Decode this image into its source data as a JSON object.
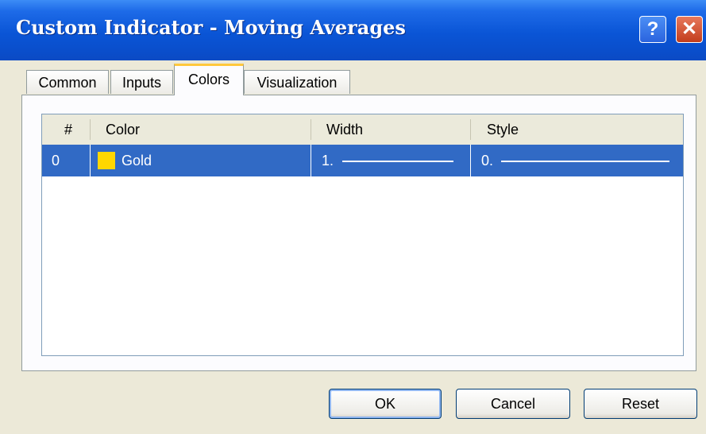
{
  "window": {
    "title": "Custom Indicator - Moving Averages",
    "help_glyph": "?",
    "close_glyph": "✕"
  },
  "tabs": [
    {
      "label": "Common"
    },
    {
      "label": "Inputs"
    },
    {
      "label": "Colors",
      "active": true
    },
    {
      "label": "Visualization"
    }
  ],
  "table": {
    "columns": [
      "#",
      "Color",
      "Width",
      "Style"
    ],
    "rows": [
      {
        "index": "0",
        "color_name": "Gold",
        "color_hex": "#FFD700",
        "width": "1.",
        "style": "0.",
        "selected": true
      }
    ]
  },
  "buttons": {
    "ok": "OK",
    "cancel": "Cancel",
    "reset": "Reset"
  },
  "colors": {
    "titlebar": "#0a55d6",
    "selection": "#316ac5",
    "active_tab_accent": "#ffc83c"
  }
}
